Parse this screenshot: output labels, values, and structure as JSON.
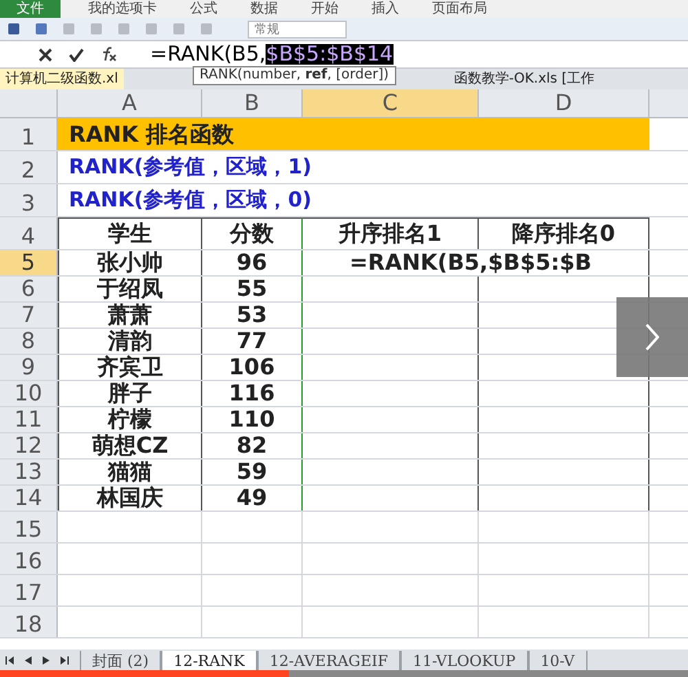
{
  "ribbon_tabs": [
    {
      "label": "文件",
      "selected": true
    },
    {
      "label": "我的选项卡",
      "selected": false
    },
    {
      "label": "公式",
      "selected": false
    },
    {
      "label": "数据",
      "selected": false
    },
    {
      "label": "开始",
      "selected": false
    },
    {
      "label": "插入",
      "selected": false
    },
    {
      "label": "页面布局",
      "selected": false
    }
  ],
  "number_format": "常规",
  "formula_bar": {
    "prefix": "=RANK(B5,",
    "highlighted": "$B$5:$B$14"
  },
  "tooltip": "RANK(number, **ref**, [order])",
  "workbook_tabs": [
    "计算机二级函数.xl",
    "函数教学-OK.xls [工作"
  ],
  "columns": [
    {
      "label": "A",
      "selected": false
    },
    {
      "label": "B",
      "selected": false
    },
    {
      "label": "C",
      "selected": true
    },
    {
      "label": "D",
      "selected": false
    }
  ],
  "rows": [
    {
      "number": "1",
      "selected": false,
      "kind": "title",
      "text": "RANK 排名函数"
    },
    {
      "number": "2",
      "selected": false,
      "kind": "syntax",
      "text": "RANK(参考值，区域，1)"
    },
    {
      "number": "3",
      "selected": false,
      "kind": "syntax",
      "text": "RANK(参考值，区域，0)"
    },
    {
      "number": "4",
      "selected": false,
      "kind": "header",
      "cells": [
        "学生",
        "分数",
        "升序排名1",
        "降序排名0"
      ]
    },
    {
      "number": "5",
      "selected": true,
      "kind": "data",
      "cells": [
        "张小帅",
        "96",
        "=RANK(B5,$B$5:$B",
        ""
      ]
    },
    {
      "number": "6",
      "selected": false,
      "kind": "data",
      "cells": [
        "于绍凤",
        "55",
        "",
        ""
      ]
    },
    {
      "number": "7",
      "selected": false,
      "kind": "data",
      "cells": [
        "萧萧",
        "53",
        "",
        ""
      ]
    },
    {
      "number": "8",
      "selected": false,
      "kind": "data",
      "cells": [
        "清韵",
        "77",
        "",
        ""
      ]
    },
    {
      "number": "9",
      "selected": false,
      "kind": "data",
      "cells": [
        "齐宾卫",
        "106",
        "",
        ""
      ]
    },
    {
      "number": "10",
      "selected": false,
      "kind": "data",
      "cells": [
        "胖子",
        "116",
        "",
        ""
      ]
    },
    {
      "number": "11",
      "selected": false,
      "kind": "data",
      "cells": [
        "柠檬",
        "110",
        "",
        ""
      ]
    },
    {
      "number": "12",
      "selected": false,
      "kind": "data",
      "cells": [
        "萌想CZ",
        "82",
        "",
        ""
      ]
    },
    {
      "number": "13",
      "selected": false,
      "kind": "data",
      "cells": [
        "猫猫",
        "59",
        "",
        ""
      ]
    },
    {
      "number": "14",
      "selected": false,
      "kind": "data",
      "cells": [
        "林国庆",
        "49",
        "",
        ""
      ]
    },
    {
      "number": "15",
      "selected": false,
      "kind": "empty"
    },
    {
      "number": "16",
      "selected": false,
      "kind": "empty"
    },
    {
      "number": "17",
      "selected": false,
      "kind": "empty"
    },
    {
      "number": "18",
      "selected": false,
      "kind": "empty"
    }
  ],
  "video_progress": {
    "level": 0.42
  },
  "sheet_tabs": [
    {
      "label": "封面 (2)",
      "selected": false
    },
    {
      "label": "12-RANK",
      "selected": true
    },
    {
      "label": "12-AVERAGEIF",
      "selected": false
    },
    {
      "label": "11-VLOOKUP",
      "selected": false
    },
    {
      "label": "10-V",
      "selected": false
    }
  ]
}
